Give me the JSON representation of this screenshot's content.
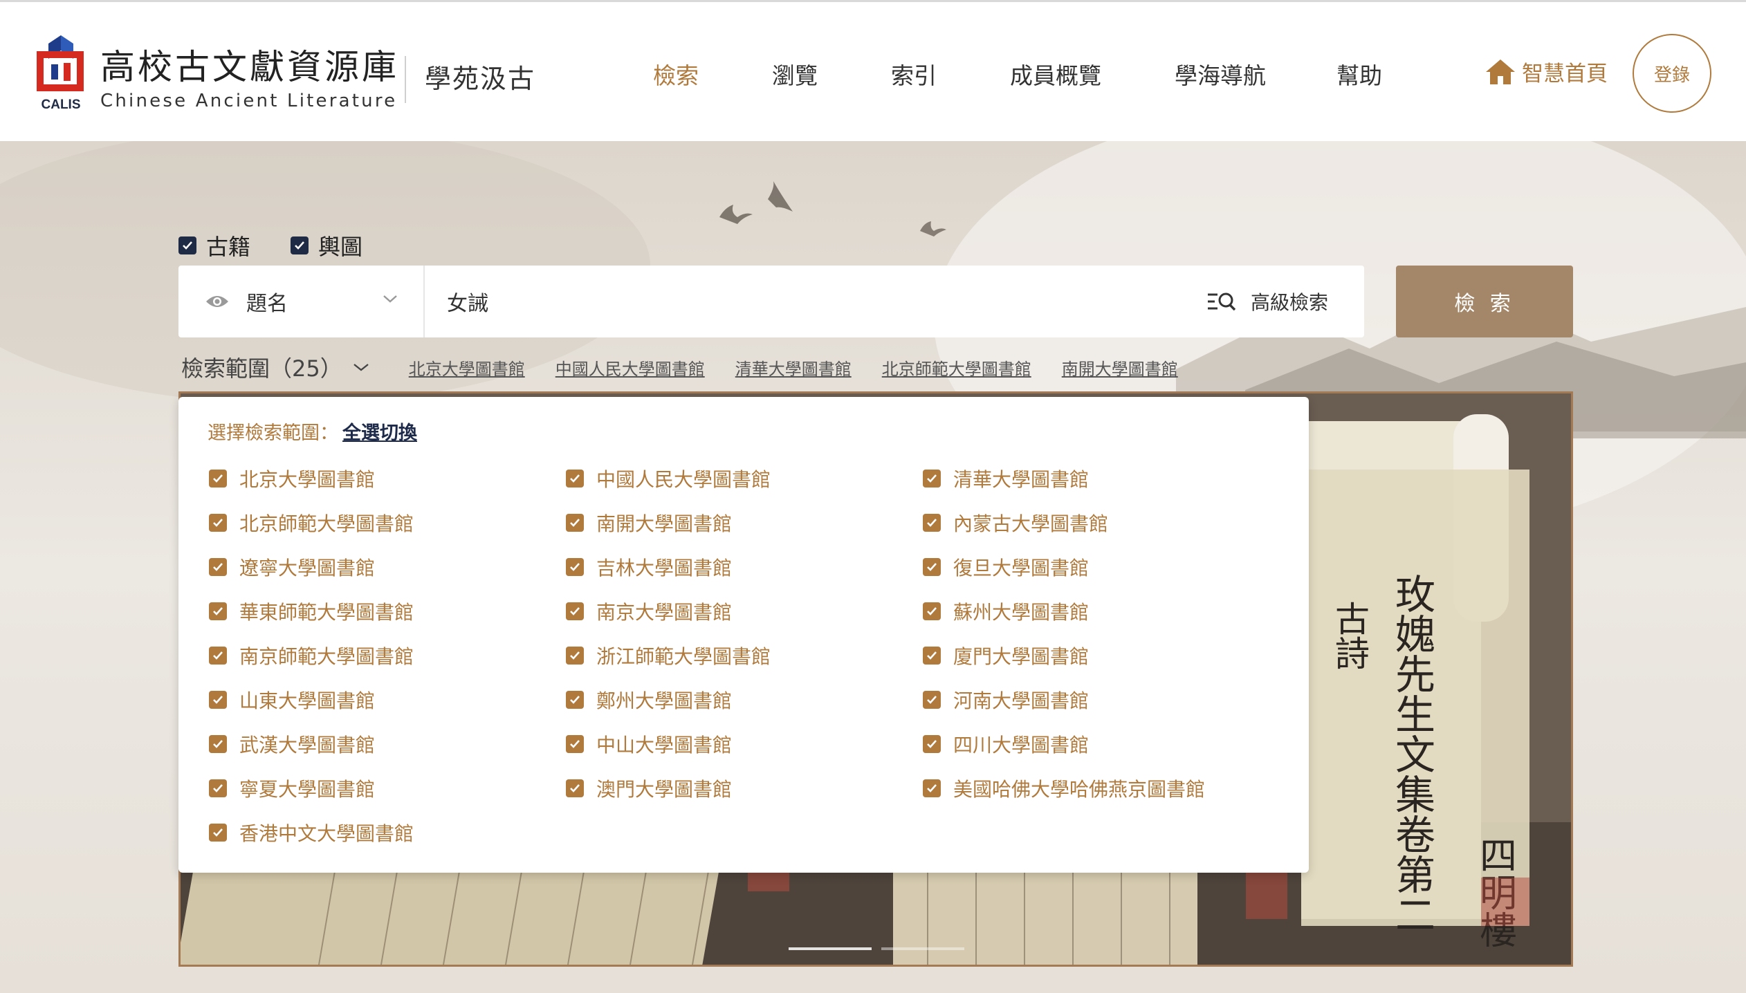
{
  "header": {
    "logo_caption": "CALIS",
    "site_title": "高校古文獻資源庫",
    "site_subtitle": "Chinese Ancient Literature",
    "slogan": "學苑汲古",
    "nav": [
      {
        "label": "檢索",
        "active": true
      },
      {
        "label": "瀏覽",
        "active": false
      },
      {
        "label": "索引",
        "active": false
      },
      {
        "label": "成員概覽",
        "active": false
      },
      {
        "label": "學海導航",
        "active": false
      },
      {
        "label": "幫助",
        "active": false
      }
    ],
    "home_link": "智慧首頁",
    "login": "登錄",
    "accent_color": "#b07a3c"
  },
  "search": {
    "resource_types": [
      {
        "label": "古籍",
        "checked": true
      },
      {
        "label": "輿圖",
        "checked": true
      }
    ],
    "field_label": "題名",
    "query": "女誡",
    "advanced_label": "高級檢索",
    "submit_label": "檢 索",
    "submit_color": "#a48769"
  },
  "scope": {
    "label": "檢索範圍（25）",
    "quick_links": [
      "北京大學圖書館",
      "中國人民大學圖書館",
      "清華大學圖書館",
      "北京師範大學圖書館",
      "南開大學圖書館"
    ]
  },
  "dropdown": {
    "heading": "選擇檢索範圍：",
    "toggle_all": "全選切換",
    "libraries": [
      "北京大學圖書館",
      "中國人民大學圖書館",
      "清華大學圖書館",
      "北京師範大學圖書館",
      "南開大學圖書館",
      "內蒙古大學圖書館",
      "遼寧大學圖書館",
      "吉林大學圖書館",
      "復旦大學圖書館",
      "華東師範大學圖書館",
      "南京大學圖書館",
      "蘇州大學圖書館",
      "南京師範大學圖書館",
      "浙江師範大學圖書館",
      "廈門大學圖書館",
      "山東大學圖書館",
      "鄭州大學圖書館",
      "河南大學圖書館",
      "武漢大學圖書館",
      "中山大學圖書館",
      "四川大學圖書館",
      "寧夏大學圖書館",
      "澳門大學圖書館",
      "美國哈佛大學哈佛燕京圖書館",
      "香港中文大學圖書館"
    ]
  },
  "banner": {
    "scroll_title": "玫媿先生文集卷第二",
    "scroll_side": "古詩",
    "scroll_mark": "四明樓"
  }
}
